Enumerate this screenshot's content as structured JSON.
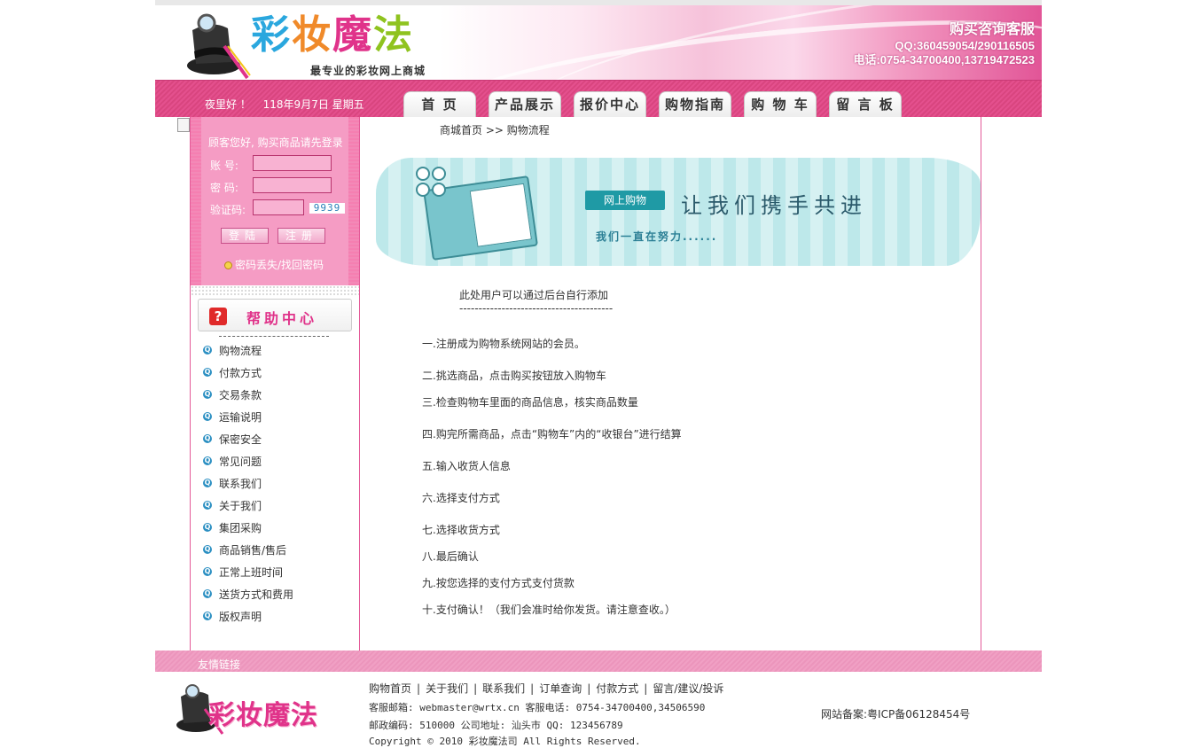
{
  "header": {
    "logo_text": "彩妆魔法",
    "slogan": "最专业的彩妆网上商城",
    "contact_title": "购买咨询客服",
    "contact_qq": "QQ:360459054/290116505",
    "contact_phone": "电话:0754-34700400,13719472523"
  },
  "nav": {
    "greeting": "夜里好 ！",
    "date": "118年9月7日 星期五",
    "tabs": [
      "首 页",
      "产品展示",
      "报价中心",
      "购物指南",
      "购 物 车",
      "留 言 板"
    ]
  },
  "login": {
    "title": "顾客您好, 购买商品请先登录",
    "account_label": "账  号:",
    "password_label": "密  码:",
    "captcha_label": "验证码:",
    "captcha_value": "9939",
    "login_button": "登陆",
    "register_button": "注册",
    "forgot_link": "密码丢失/找回密码"
  },
  "help": {
    "title": "帮助中心",
    "items": [
      "购物流程",
      "付款方式",
      "交易条款",
      "运输说明",
      "保密安全",
      "常见问题",
      "联系我们",
      "关于我们",
      "集团采购",
      "商品销售/售后",
      "正常上班时间",
      "送货方式和费用",
      "版权声明"
    ]
  },
  "breadcrumb": {
    "home": "商城首页",
    "sep": ">>",
    "current": "购物流程"
  },
  "banner": {
    "tag": "网上购物",
    "slogan": "让我们携手共进",
    "sub": "我们一直在努力......"
  },
  "content": {
    "note": "此处用户可以通过后台自行添加",
    "dash": "----------------------------------------",
    "steps": [
      "一.注册成为购物系统网站的会员。",
      "二.挑选商品，点击购买按钮放入购物车",
      "三.检查购物车里面的商品信息，核实商品数量",
      "四.购完所需商品，点击“购物车”内的“收银台”进行结算",
      "五.输入收货人信息",
      "六.选择支付方式",
      "七.选择收货方式",
      "八.最后确认",
      "九.按您选择的支付方式支付货款",
      "十.支付确认！（我们会准时给你发货。请注意查收。）"
    ]
  },
  "footer": {
    "friend_links": "友情链接",
    "logo_text": "彩妆魔法",
    "links": [
      "购物首页",
      "关于我们",
      "联系我们",
      "订单查询",
      "付款方式",
      "留言/建议/投诉"
    ],
    "line1": "客服邮箱: webmaster@wrtx.cn  客服电话: 0754-34700400,34506590",
    "line2": "邮政编码: 510000 公司地址: 汕头市 QQ: 123456789",
    "line3": "Copyright © 2010 彩妆魔法司 All Rights Reserved.",
    "icp": "网站备案:粤ICP备06128454号"
  },
  "colors": {
    "brand_pink": "#e4508e",
    "teal": "#1f9aa5"
  }
}
